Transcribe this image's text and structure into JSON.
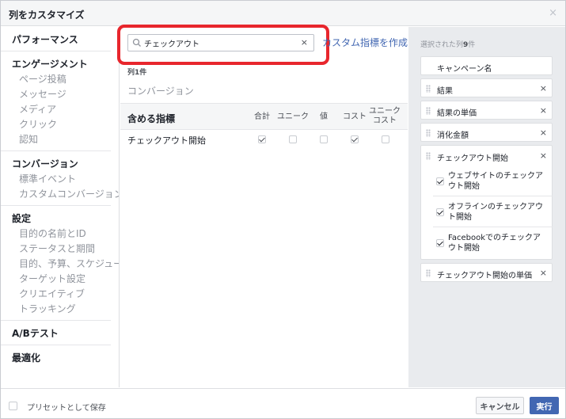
{
  "dialog": {
    "title": "列をカスタマイズ",
    "close": "×"
  },
  "sidebar": {
    "groups": [
      {
        "head": "パフォーマンス",
        "items": []
      },
      {
        "head": "エンゲージメント",
        "items": [
          "ページ投稿",
          "メッセージ",
          "メディア",
          "クリック",
          "認知"
        ]
      },
      {
        "head": "コンバージョン",
        "items": [
          "標準イベント",
          "カスタムコンバージョン"
        ]
      },
      {
        "head": "設定",
        "items": [
          "目的の名前とID",
          "ステータスと期間",
          "目的、予算、スケジュール",
          "ターゲット設定",
          "クリエイティブ",
          "トラッキング"
        ]
      },
      {
        "head": "A/Bテスト",
        "items": []
      },
      {
        "head": "最適化",
        "items": []
      }
    ]
  },
  "search": {
    "value": "チェックアウト",
    "clear": "×"
  },
  "create_metric_link": "カスタム指標を作成",
  "results": {
    "count_prefix": "列",
    "count_number": "1",
    "count_suffix": "件",
    "section": "コンバージョン"
  },
  "table": {
    "header": "含める指標",
    "columns": [
      "合計",
      "ユニーク",
      "値",
      "コスト",
      "ユニーク\nコスト"
    ],
    "rows": [
      {
        "label": "チェックアウト開始",
        "checked": [
          true,
          false,
          false,
          true,
          false
        ]
      }
    ]
  },
  "selected": {
    "head_prefix": "選択された列",
    "head_number": "9",
    "head_suffix": "件",
    "fixed": "キャンペーン名",
    "items": [
      "結果",
      "結果の単価",
      "消化金額",
      "チェックアウト開始"
    ],
    "sub_items": [
      "ウェブサイトのチェックアウト開始",
      "オフラインのチェックアウト開始",
      "Facebookでのチェックアウト開始"
    ],
    "last": "チェックアウト開始の単価",
    "remove": "×"
  },
  "footer": {
    "preset_label": "プリセットとして保存",
    "cancel": "キャンセル",
    "run": "実行"
  },
  "colors": {
    "accent": "#4267b2",
    "highlight": "#e8262d",
    "panel": "#e9ebee"
  }
}
